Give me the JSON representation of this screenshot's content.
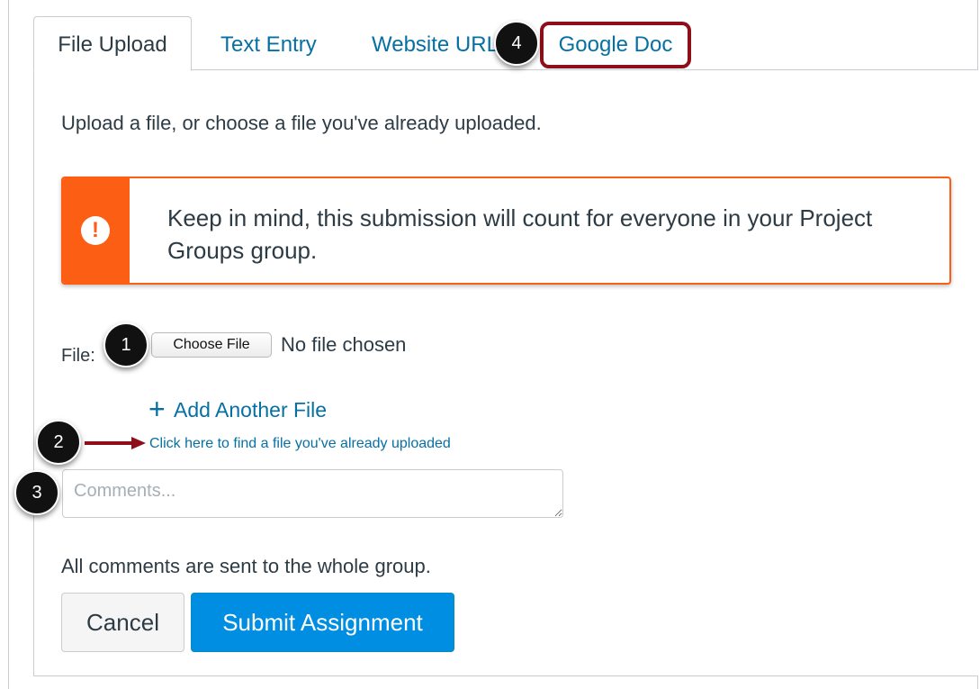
{
  "tabs": {
    "file_upload": "File Upload",
    "text_entry": "Text Entry",
    "website_url": "Website URL",
    "google_doc": "Google Doc"
  },
  "intro": "Upload a file, or choose a file you've already uploaded.",
  "alert": {
    "icon": "exclamation-icon",
    "text": "Keep in mind, this submission will count for everyone in your Project Groups group."
  },
  "file_row": {
    "label": "File:",
    "choose_button": "Choose File",
    "status": "No file chosen"
  },
  "add_another": {
    "icon": "plus-icon",
    "label": "Add Another File"
  },
  "find_uploaded_link": "Click here to find a file you've already uploaded",
  "comments": {
    "placeholder": "Comments...",
    "value": ""
  },
  "group_note": "All comments are sent to the whole group.",
  "buttons": {
    "cancel": "Cancel",
    "submit": "Submit Assignment"
  },
  "callouts": [
    "1",
    "2",
    "3",
    "4"
  ],
  "colors": {
    "link": "#0770a3",
    "warning": "#fc5e13",
    "primary": "#008ee2",
    "highlight": "#8e0f1a"
  }
}
